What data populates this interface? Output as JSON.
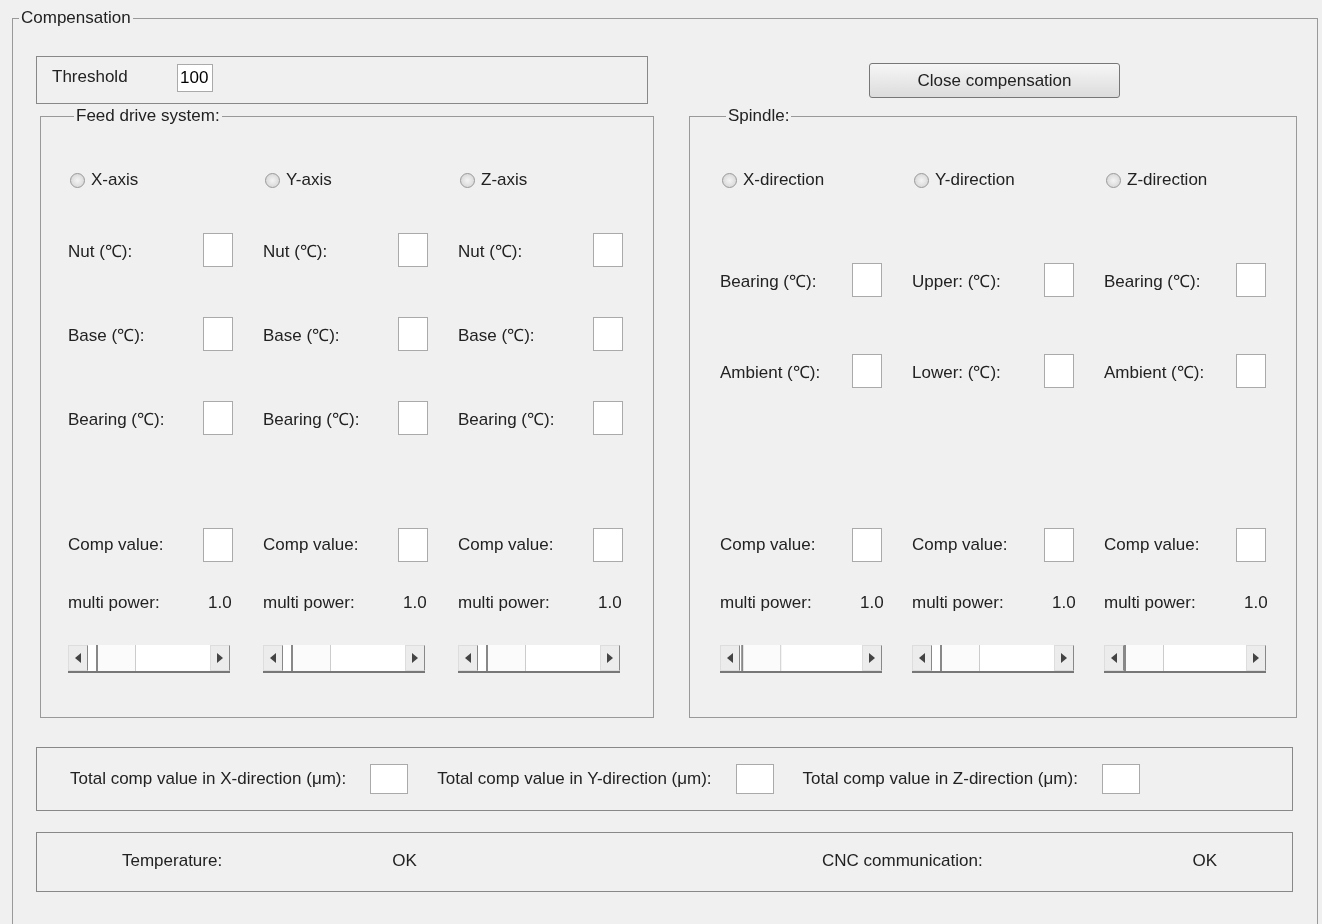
{
  "group_title": "Compensation",
  "threshold": {
    "label": "Threshold",
    "value": "100"
  },
  "close_button": "Close compensation",
  "panels": [
    {
      "title": "Feed drive system:",
      "columns": [
        {
          "radio": {
            "label": "X-axis",
            "selected": false
          },
          "sensors": [
            "Nut (℃):",
            "Base (℃):",
            "Bearing (℃):"
          ],
          "comp_label": "Comp value:",
          "multi_label": "multi power:",
          "multi_value": "1.0",
          "level": 0.1
        },
        {
          "radio": {
            "label": "Y-axis",
            "selected": false
          },
          "sensors": [
            "Nut (℃):",
            "Base (℃):",
            "Bearing (℃):"
          ],
          "comp_label": "Comp value:",
          "multi_label": "multi power:",
          "multi_value": "1.0",
          "level": 0.1
        },
        {
          "radio": {
            "label": "Z-axis",
            "selected": false
          },
          "sensors": [
            "Nut (℃):",
            "Base (℃):",
            "Bearing (℃):"
          ],
          "comp_label": "Comp value:",
          "multi_label": "multi power:",
          "multi_value": "1.0",
          "level": 0.1
        }
      ]
    },
    {
      "title": "Spindle:",
      "columns": [
        {
          "radio": {
            "label": "X-direction",
            "selected": false
          },
          "sensors": [
            "Bearing (℃):",
            "Ambient (℃):"
          ],
          "comp_label": "Comp value:",
          "multi_label": "multi power:",
          "multi_value": "1.0",
          "level": 0.02
        },
        {
          "radio": {
            "label": "Y-direction",
            "selected": false
          },
          "sensors": [
            "Upper: (℃):",
            "Lower: (℃):"
          ],
          "comp_label": "Comp value:",
          "multi_label": "multi power:",
          "multi_value": "1.0",
          "level": 0.1
        },
        {
          "radio": {
            "label": "Z-direction",
            "selected": false
          },
          "sensors": [
            "Bearing (℃):",
            "Ambient (℃):"
          ],
          "comp_label": "Comp value:",
          "multi_label": "multi power:",
          "multi_value": "1.0",
          "level": 0.0
        }
      ]
    }
  ],
  "totals": [
    "Total comp value in X-direction (μm):",
    "Total comp value in Y-direction (μm):",
    "Total comp value in Z-direction (μm):"
  ],
  "status": [
    {
      "label": "Temperature:",
      "value": "OK"
    },
    {
      "label": "CNC communication:",
      "value": "OK"
    }
  ]
}
